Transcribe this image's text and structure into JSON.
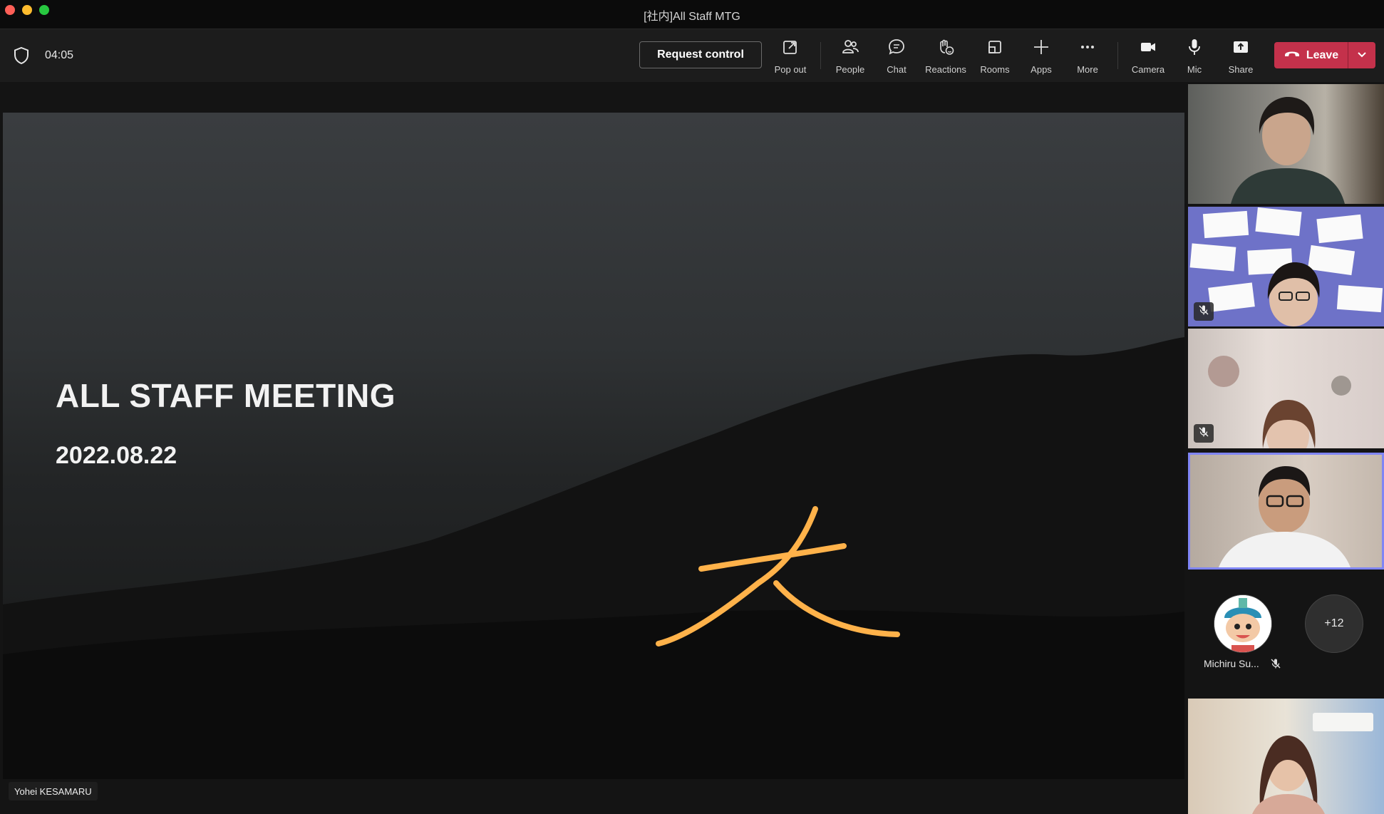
{
  "window": {
    "title": "[社内]All Staff MTG"
  },
  "toolbar": {
    "timer": "04:05",
    "request_control": "Request control",
    "items": [
      {
        "label": "Pop out",
        "icon": "pop-out-icon"
      },
      {
        "label": "People",
        "icon": "people-icon"
      },
      {
        "label": "Chat",
        "icon": "chat-icon"
      },
      {
        "label": "Reactions",
        "icon": "reactions-icon"
      },
      {
        "label": "Rooms",
        "icon": "rooms-icon"
      },
      {
        "label": "Apps",
        "icon": "plus-icon"
      },
      {
        "label": "More",
        "icon": "more-icon"
      },
      {
        "label": "Camera",
        "icon": "camera-icon"
      },
      {
        "label": "Mic",
        "icon": "mic-icon"
      },
      {
        "label": "Share",
        "icon": "share-icon"
      }
    ],
    "leave": "Leave",
    "leave_color": "#c4314b"
  },
  "stage": {
    "slide_title": "ALL STAFF MEETING",
    "slide_date": "2022.08.22",
    "presenter": "Yohei KESAMARU"
  },
  "participants": {
    "tiles": [
      {
        "name": "participant-1",
        "muted": false
      },
      {
        "name": "participant-2",
        "muted": true
      },
      {
        "name": "participant-3",
        "muted": true
      },
      {
        "name": "participant-4",
        "muted": false,
        "active_speaker": true
      },
      {
        "name": "participant-5",
        "muted": false
      }
    ],
    "avatar_person": {
      "name": "Michiru Su...",
      "muted": true
    },
    "overflow_count": "+12",
    "highlight_color": "#7f85f5"
  }
}
